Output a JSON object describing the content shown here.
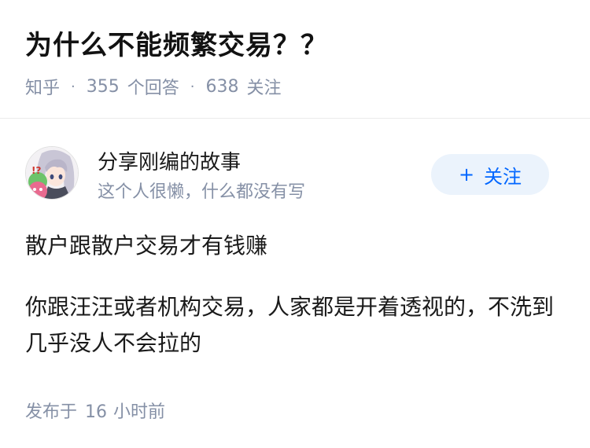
{
  "question": {
    "title": "为什么不能频繁交易？？",
    "source": "知乎",
    "separator": "·",
    "answers_count": "355",
    "answers_label": "个回答",
    "followers_count": "638",
    "followers_label": "关注"
  },
  "author": {
    "name": "分享刚编的故事",
    "bio": "这个人很懒，什么都没有写",
    "follow_plus": "+",
    "follow_label": "关注"
  },
  "answer": {
    "paragraphs": [
      "散户跟散户交易才有钱赚",
      "你跟汪汪或者机构交易，人家都是开着透视的，不洗到几乎没人不会拉的"
    ],
    "posted_prefix": "发布于",
    "posted_number": "16",
    "posted_unit": "小时前"
  },
  "colors": {
    "meta_gray": "#8590a6",
    "brand_blue": "#0066ff",
    "follow_bg": "#ebf3fc"
  }
}
